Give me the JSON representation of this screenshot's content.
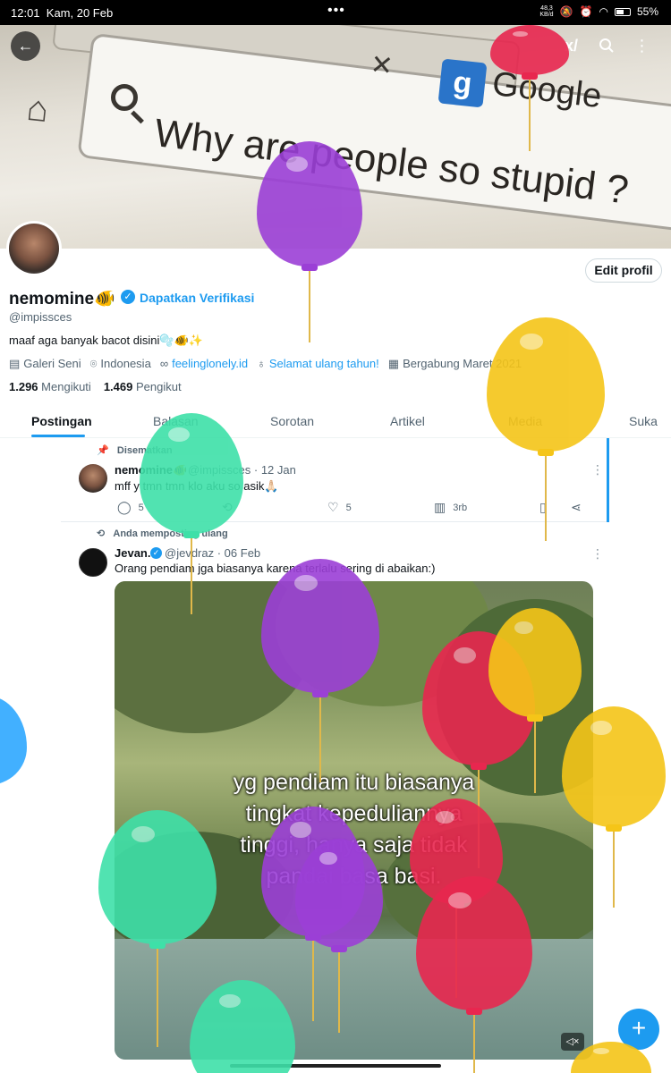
{
  "status_bar": {
    "time": "12:01",
    "date": "Kam, 20 Feb",
    "net_speed_top": "48,3",
    "net_speed_bottom": "KB/d",
    "battery": "55%"
  },
  "header": {
    "back_icon": "arrow-left-icon",
    "grok_icon": "grok-icon",
    "search_icon": "search-icon",
    "more_icon": "more-vertical-icon"
  },
  "banner": {
    "search_query": "Why are people so stupid ?",
    "brand_badge": "g",
    "brand_word": "Google"
  },
  "profile": {
    "edit_button": "Edit profil",
    "display_name": "nemomine🐠",
    "get_verified": "Dapatkan Verifikasi",
    "handle": "@impissces",
    "bio": "maaf aga banyak bacot disini🫧🐠✨",
    "category": "Galeri Seni",
    "location": "Indonesia",
    "website": "feelinglonely.id",
    "birthday": "Selamat ulang tahun!",
    "joined": "Bergabung Maret 2021",
    "following_count": "1.296",
    "following_label": "Mengikuti",
    "followers_count": "1.469",
    "followers_label": "Pengikut"
  },
  "tabs": [
    "Postingan",
    "Balasan",
    "Sorotan",
    "Artikel",
    "Media",
    "Suka"
  ],
  "posts": [
    {
      "context": "Disematkan",
      "name": "nemomine🐠",
      "handle": "@impissces",
      "date": "· 12 Jan",
      "text": "mff y tmn tmn klo aku so asik🙏🏻",
      "replies": "5",
      "retweets": "",
      "likes": "5",
      "views": "3rb"
    },
    {
      "context": "Anda memposting ulang",
      "name": "Jevan.",
      "handle": "@jevdraz",
      "date": "· 06 Feb",
      "text": "Orang pendiam jga biasanya karena terlalu sering di abaikan:)",
      "media_caption": [
        "yg pendiam itu biasanya",
        "tingkat kepeduliannya",
        "tinggi, hanya saja tidak",
        "pandai basa basi."
      ]
    }
  ],
  "fab_label": "+",
  "colors": {
    "accent": "#1d9bf0",
    "text": "#0f1419",
    "muted": "#536471",
    "balloon_purple": "#9b3fd6",
    "balloon_red": "#e8274f",
    "balloon_yellow": "#f5c518",
    "balloon_green": "#3ee0a8",
    "balloon_blue": "#2ea7ff"
  }
}
